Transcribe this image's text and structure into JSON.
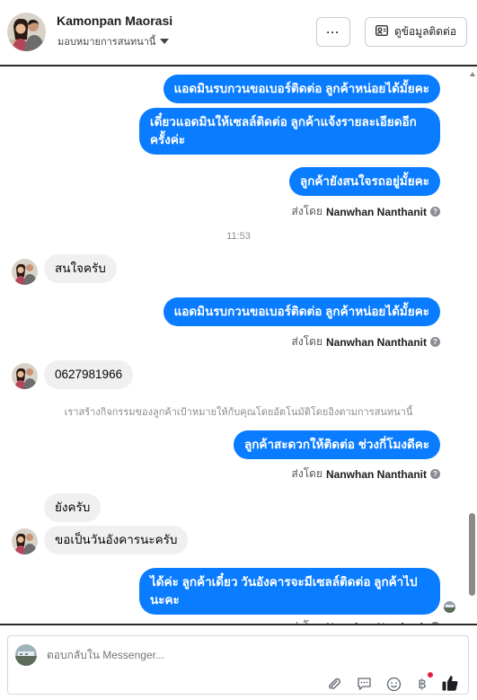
{
  "header": {
    "contact_name": "Kamonpan Maorasi",
    "assign_label": "มอบหมายการสนทนานี้",
    "more_label": "···",
    "info_label": "ดูข้อมูลติดต่อ"
  },
  "thread": {
    "messages": [
      {
        "dir": "out",
        "text": "แอดมินรบกวนขอเบอร์ติดต่อ ลูกค้าหน่อยได้มั้ยคะ"
      },
      {
        "dir": "out",
        "text": "เดี๋ยวแอดมินให้เซลล์ติดต่อ ลูกค้าแจ้งรายละเอียดอีกครั้งค่ะ"
      },
      {
        "dir": "out",
        "text": "ลูกค้ายังสนใจรถอยู่มั้ยคะ"
      },
      {
        "dir": "in",
        "text": "สนใจครับ"
      },
      {
        "dir": "out",
        "text": "แอดมินรบกวนขอเบอร์ติดต่อ ลูกค้าหน่อยได้มั้ยคะ"
      },
      {
        "dir": "in",
        "text": "0627981966"
      },
      {
        "dir": "out",
        "text": "ลูกค้าสะดวกให้ติดต่อ ช่วงกี่โมงดีคะ"
      },
      {
        "dir": "in",
        "text": "ยังครับ"
      },
      {
        "dir": "in",
        "text": "ขอเป็นวันอังคารนะครับ"
      },
      {
        "dir": "out",
        "text": "ได้ค่ะ ลูกค้าเดี๋ยว วันอังคารจะมีเซลล์ติดต่อ ลูกค้าไปนะคะ"
      }
    ],
    "sent_by_prefix": "ส่งโดย",
    "sent_by_name": "Nanwhan Nanthanit",
    "time_separator": "11:53",
    "system_note": "เราสร้างกิจกรรมของลูกค้าเป้าหมายให้กับคุณโดยอัตโนมัติโดยอิงตามการสนทนานี้"
  },
  "composer": {
    "placeholder": "ตอบกลับใน Messenger..."
  },
  "colors": {
    "outgoing_bubble": "#0a7cff",
    "incoming_bubble": "#f0f0f0",
    "like_icon": "#1c1e21",
    "badge": "#e41e3f"
  }
}
